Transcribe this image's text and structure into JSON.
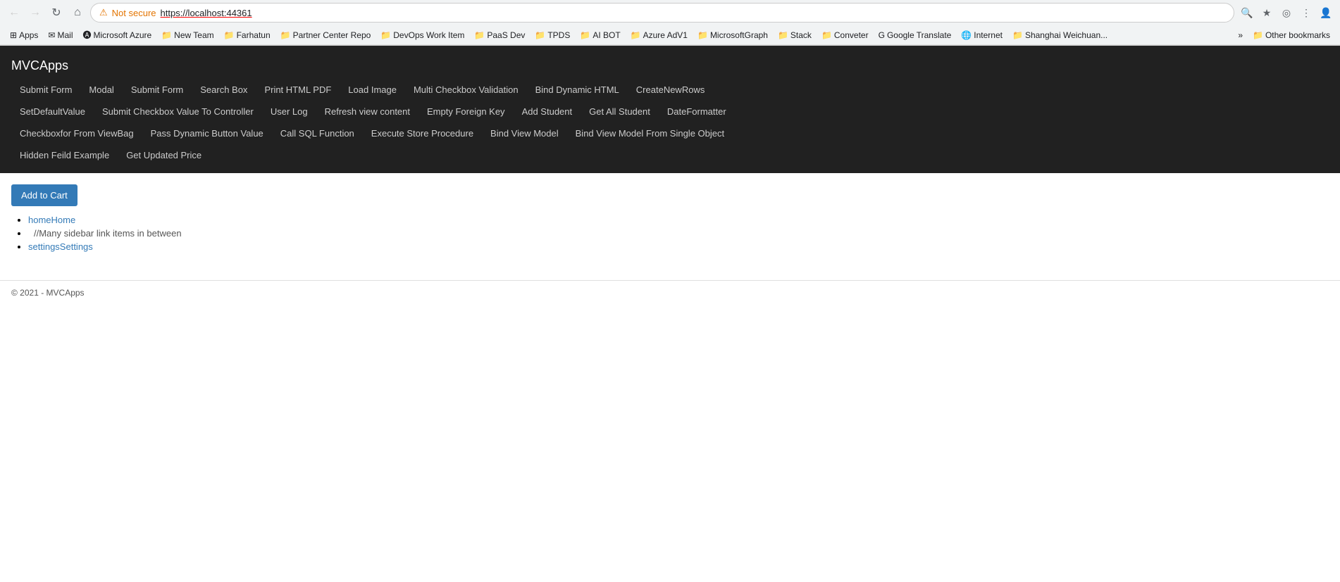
{
  "browser": {
    "url": "https://localhost:44361",
    "security_warning": "Not secure",
    "nav": {
      "back_disabled": true,
      "forward_disabled": true,
      "reload_label": "⟳",
      "home_label": "⌂"
    }
  },
  "bookmarks": [
    {
      "label": "Apps",
      "icon": "⊞"
    },
    {
      "label": "Mail",
      "icon": "✉"
    },
    {
      "label": "Microsoft Azure",
      "icon": "A"
    },
    {
      "label": "New Team",
      "icon": "📁"
    },
    {
      "label": "Farhatun",
      "icon": "📁"
    },
    {
      "label": "Partner Center Repo",
      "icon": "📁"
    },
    {
      "label": "DevOps Work Item",
      "icon": "📁"
    },
    {
      "label": "PaaS Dev",
      "icon": "📁"
    },
    {
      "label": "TPDS",
      "icon": "📁"
    },
    {
      "label": "AI BOT",
      "icon": "📁"
    },
    {
      "label": "Azure AdV1",
      "icon": "📁"
    },
    {
      "label": "MicrosoftGraph",
      "icon": "📁"
    },
    {
      "label": "Stack",
      "icon": "📁"
    },
    {
      "label": "Conveter",
      "icon": "📁"
    },
    {
      "label": "Google Translate",
      "icon": "G"
    },
    {
      "label": "Internet",
      "icon": "🌐"
    },
    {
      "label": "Shanghai Weichuan...",
      "icon": "📁"
    },
    {
      "label": "»",
      "icon": ""
    },
    {
      "label": "Other bookmarks",
      "icon": "📁"
    }
  ],
  "navbar": {
    "brand": "MVCApps",
    "rows": [
      [
        "Submit Form",
        "Modal",
        "Submit Form",
        "Search Box",
        "Print HTML PDF",
        "Load Image",
        "Multi Checkbox Validation",
        "Bind Dynamic HTML",
        "CreateNewRows"
      ],
      [
        "SetDefaultValue",
        "Submit Checkbox Value To Controller",
        "User Log",
        "Refresh view content",
        "Empty Foreign Key",
        "Add Student",
        "Get All Student",
        "DateFormatter"
      ],
      [
        "Checkboxfor From ViewBag",
        "Pass Dynamic Button Value",
        "Call SQL Function",
        "Execute Store Procedure",
        "Bind View Model",
        "Bind View Model From Single Object"
      ],
      [
        "Hidden Feild Example",
        "Get Updated Price"
      ]
    ]
  },
  "main": {
    "add_to_cart_label": "Add to Cart",
    "sidebar_links": [
      {
        "text": "homeHome",
        "href": "#"
      },
      {
        "text": "settingsSettings",
        "href": "#"
      }
    ],
    "sidebar_middle_text": "//Many sidebar link items in between"
  },
  "footer": {
    "copyright": "© 2021 - MVCApps"
  }
}
